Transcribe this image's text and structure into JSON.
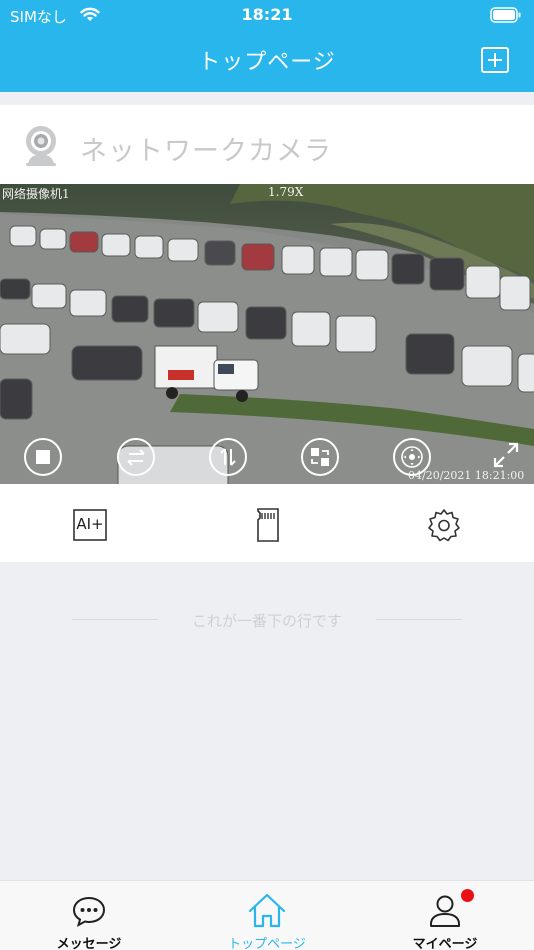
{
  "status_bar": {
    "carrier": "SIMなし",
    "time": "18:21"
  },
  "nav": {
    "title": "トップページ",
    "add_icon": "plus-square-icon"
  },
  "camera": {
    "name": "ネットワークカメラ",
    "icon": "webcam-icon",
    "overlay_label": "网络摄像机1",
    "zoom": "1.79X",
    "timestamp": "04/20/2021 18:21:00"
  },
  "video_controls": [
    {
      "name": "stop",
      "icon": "stop-icon"
    },
    {
      "name": "swap-horizontal",
      "icon": "swap-horizontal-icon"
    },
    {
      "name": "swap-vertical",
      "icon": "swap-vertical-icon"
    },
    {
      "name": "switch-view",
      "icon": "switch-view-icon"
    },
    {
      "name": "ptz",
      "icon": "ptz-joystick-icon"
    },
    {
      "name": "fullscreen",
      "icon": "fullscreen-icon"
    }
  ],
  "actions": [
    {
      "name": "ai",
      "label": "AI+",
      "icon": "ai-plus-icon"
    },
    {
      "name": "sd-card",
      "icon": "sd-card-icon"
    },
    {
      "name": "settings",
      "icon": "gear-icon"
    }
  ],
  "end_message": "これが一番下の行です",
  "tabs": [
    {
      "label": "メッセージ",
      "icon": "chat-bubble-icon",
      "active": false
    },
    {
      "label": "トップページ",
      "icon": "home-icon",
      "active": true
    },
    {
      "label": "マイページ",
      "icon": "person-icon",
      "active": false,
      "badge": true
    }
  ],
  "colors": {
    "accent": "#29b6ec",
    "badge": "#e81212"
  }
}
